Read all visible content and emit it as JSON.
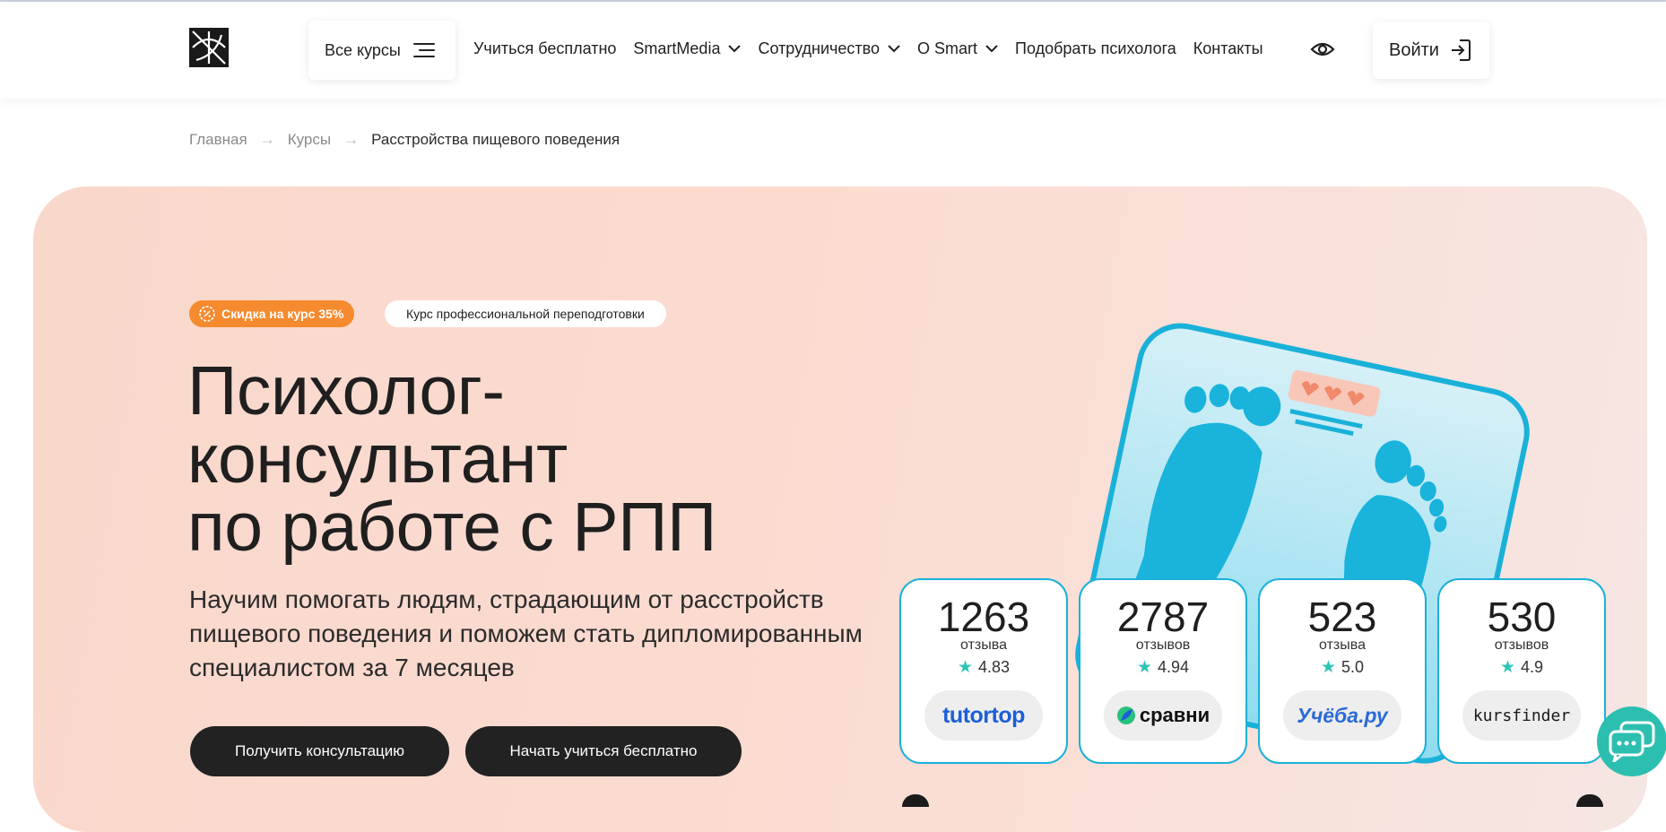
{
  "header": {
    "all_courses_label": "Все курсы",
    "nav": [
      {
        "label": "Учиться бесплатно",
        "has_dropdown": false
      },
      {
        "label": "SmartMedia",
        "has_dropdown": true
      },
      {
        "label": "Сотрудничество",
        "has_dropdown": true
      },
      {
        "label": "O Smart",
        "has_dropdown": true
      },
      {
        "label": "Подобрать психолога",
        "has_dropdown": false
      },
      {
        "label": "Контакты",
        "has_dropdown": false
      }
    ],
    "login_label": "Войти",
    "icons": {
      "logo": "logo-mark-icon",
      "menu": "burger-icon",
      "accessibility": "eye-icon",
      "login": "login-arrow-icon",
      "chevron": "chevron-down-icon"
    }
  },
  "breadcrumb": {
    "items": [
      "Главная",
      "Курсы"
    ],
    "current": "Расстройства пищевого поведения",
    "separator": "→"
  },
  "hero": {
    "badge_sale": "Скидка на курс 35%",
    "badge_type": "Курс профессиональной переподготовки",
    "title_lines": [
      "Психолог-",
      "консультант",
      "по работе с РПП"
    ],
    "subtitle": "Научим помогать людям, страдающим от расстройств пищевого поведения и поможем стать дипломированным специалистом за 7 месяцев",
    "buttons": {
      "consult": "Получить консультацию",
      "free": "Начать учиться бесплатно"
    }
  },
  "reviews": [
    {
      "count": "1263",
      "label": "отзыва",
      "rating": "4.83",
      "platform": "tutortop"
    },
    {
      "count": "2787",
      "label": "отзывов",
      "rating": "4.94",
      "platform": "сравни"
    },
    {
      "count": "523",
      "label": "отзыва",
      "rating": "5.0",
      "platform": "Учёба.ру"
    },
    {
      "count": "530",
      "label": "отзывов",
      "rating": "4.9",
      "platform": "kursfinder"
    }
  ],
  "colors": {
    "accent_orange": "#f58a2f",
    "teal": "#2cbfb0",
    "scale_blue": "#1ab1d9",
    "dark_button": "#222222",
    "hero_bg": "#fbdbd0"
  }
}
